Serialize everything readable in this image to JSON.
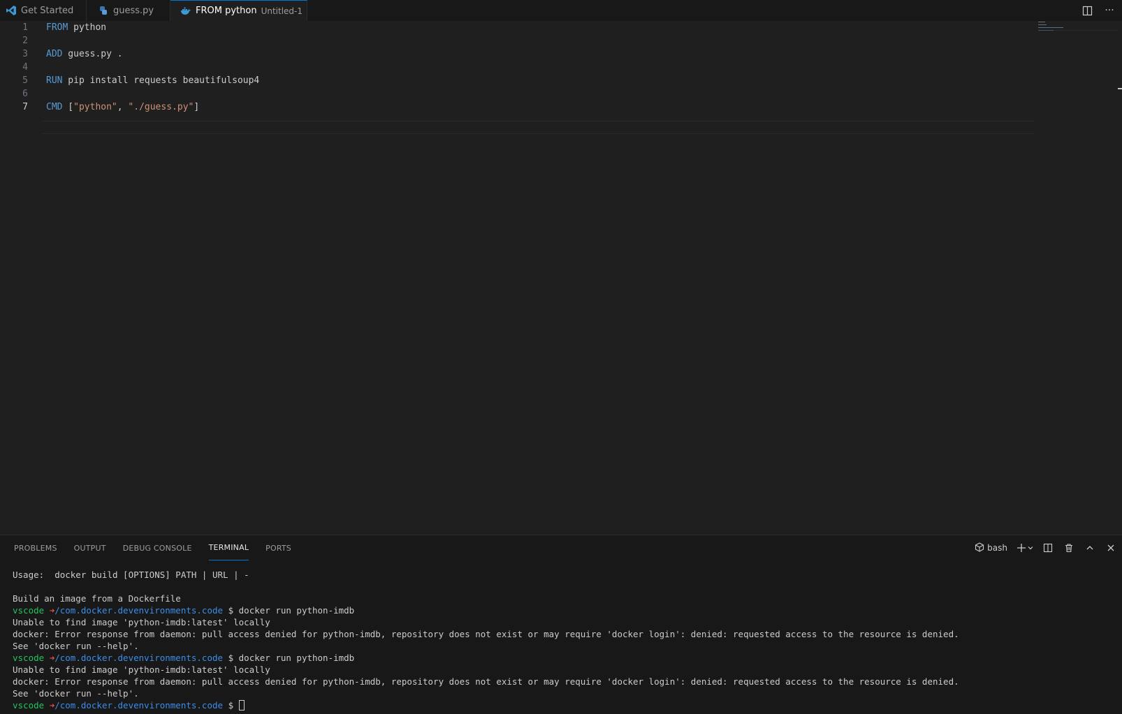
{
  "tabs": [
    {
      "label": "Get Started",
      "icon": "vscode-logo-icon"
    },
    {
      "label": "guess.py",
      "icon": "python-icon"
    },
    {
      "label": "FROM python",
      "sub": "Untitled-1",
      "icon": "docker-icon",
      "active": true,
      "dirty": true
    }
  ],
  "editor": {
    "lines": [
      {
        "n": "1",
        "kw": "FROM",
        "rest": " python"
      },
      {
        "n": "2",
        "kw": "",
        "rest": ""
      },
      {
        "n": "3",
        "kw": "ADD",
        "rest": " guess.py ."
      },
      {
        "n": "4",
        "kw": "",
        "rest": ""
      },
      {
        "n": "5",
        "kw": "RUN",
        "rest": " pip install requests beautifulsoup4"
      },
      {
        "n": "6",
        "kw": "",
        "rest": ""
      },
      {
        "n": "7",
        "kw": "CMD",
        "p1": " [",
        "s1": "\"python\"",
        "p2": ", ",
        "s2": "\"./guess.py\"",
        "p3": "]"
      }
    ]
  },
  "panel": {
    "tabs": [
      "PROBLEMS",
      "OUTPUT",
      "DEBUG CONSOLE",
      "TERMINAL",
      "PORTS"
    ],
    "active_tab": "TERMINAL",
    "shell": "bash"
  },
  "terminal": {
    "usage": "Usage:  docker build [OPTIONS] PATH | URL | -",
    "build_desc": "Build an image from a Dockerfile",
    "prompt_user": "vscode",
    "prompt_arrow": "➜",
    "prompt_path": "/com.docker.devenvironments.code",
    "prompt_symbol": "$",
    "cmd": "docker run python-imdb",
    "unable": "Unable to find image 'python-imdb:latest' locally",
    "error": "docker: Error response from daemon: pull access denied for python-imdb, repository does not exist or may require 'docker login': denied: requested access to the resource is denied.",
    "see_help": "See 'docker run --help'."
  },
  "colors": {
    "accent": "#0078d4",
    "keyword": "#569cd6",
    "string": "#ce9178",
    "prompt_user": "#22c55e",
    "prompt_arrow": "#f14c4c",
    "prompt_path": "#3b8eea"
  }
}
